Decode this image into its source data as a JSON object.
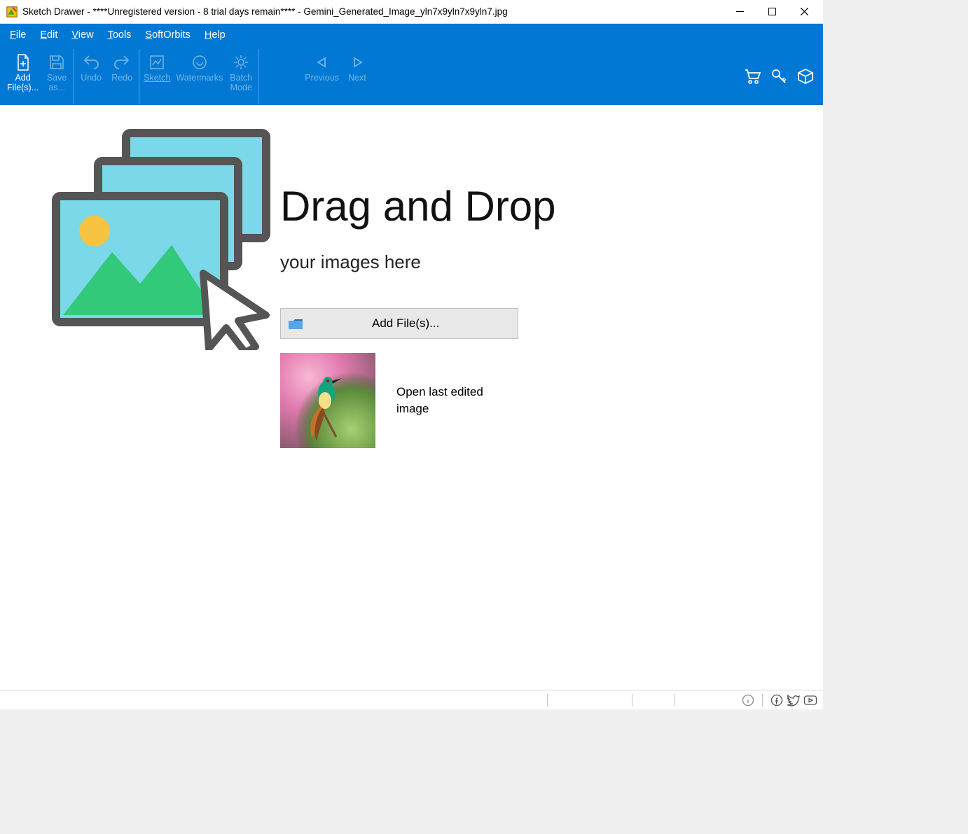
{
  "window": {
    "title": "Sketch Drawer - ****Unregistered version - 8 trial days remain**** - Gemini_Generated_Image_yln7x9yln7x9yln7.jpg"
  },
  "menu": {
    "file": "File",
    "edit": "Edit",
    "view": "View",
    "tools": "Tools",
    "softorbits": "SoftOrbits",
    "help": "Help"
  },
  "toolbar": {
    "add_files": "Add\nFile(s)...",
    "save_as": "Save\nas...",
    "undo": "Undo",
    "redo": "Redo",
    "sketch": "Sketch",
    "watermarks": "Watermarks",
    "batch_mode": "Batch\nMode",
    "previous": "Previous",
    "next": "Next"
  },
  "main": {
    "drag_title": "Drag and Drop",
    "drag_sub": "your images here",
    "add_files_btn": "Add File(s)...",
    "open_last": "Open last edited image"
  }
}
